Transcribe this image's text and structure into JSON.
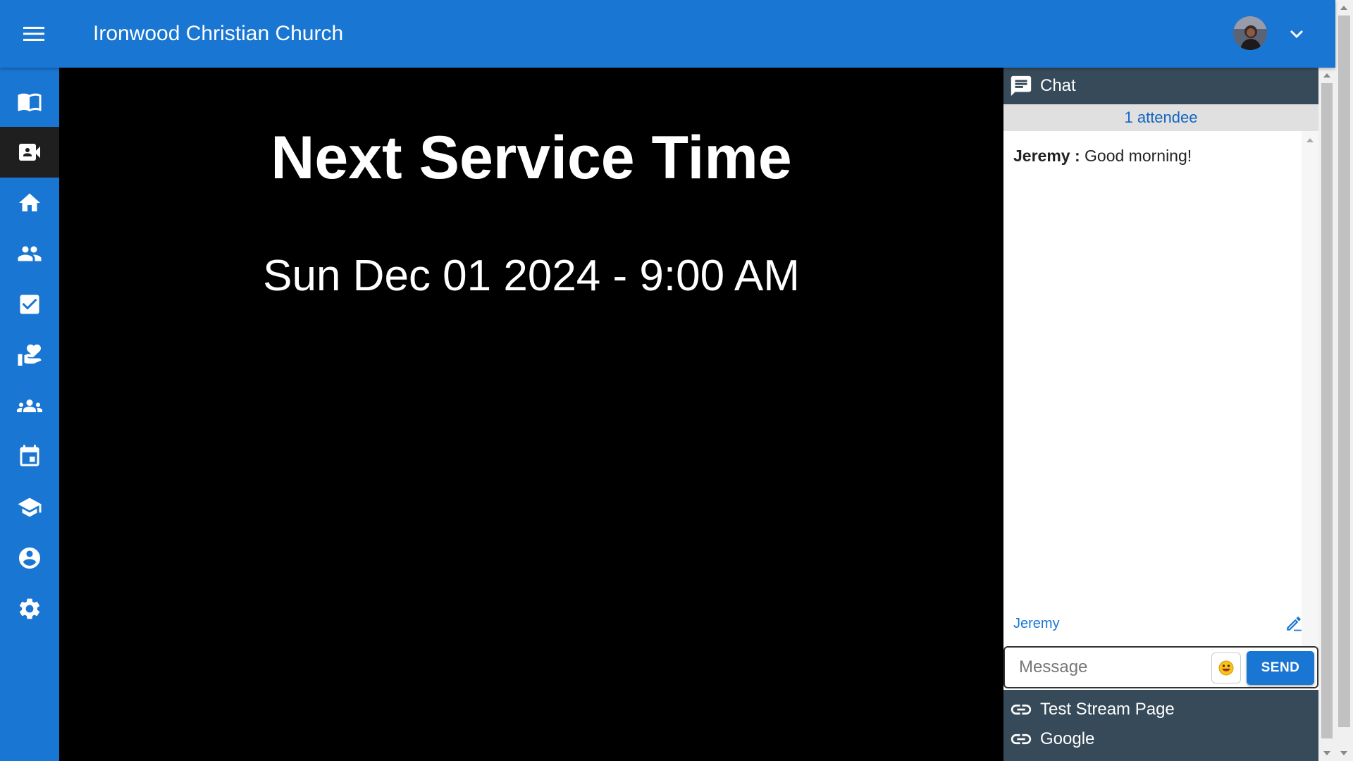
{
  "header": {
    "title": "Ironwood Christian Church",
    "menu_icon": "menu-icon",
    "avatar_icon": "user-avatar",
    "caret_icon": "chevron-down-icon"
  },
  "sidebar": {
    "items": [
      {
        "name": "sidebar-item-bible",
        "icon": "book-open-icon",
        "active": false
      },
      {
        "name": "sidebar-item-stream",
        "icon": "video-camera-icon",
        "active": true
      },
      {
        "name": "sidebar-item-home",
        "icon": "home-icon",
        "active": false
      },
      {
        "name": "sidebar-item-people",
        "icon": "people-icon",
        "active": false
      },
      {
        "name": "sidebar-item-tasks",
        "icon": "checkbox-icon",
        "active": false
      },
      {
        "name": "sidebar-item-donate",
        "icon": "volunteer-heart-icon",
        "active": false
      },
      {
        "name": "sidebar-item-groups",
        "icon": "groups-icon",
        "active": false
      },
      {
        "name": "sidebar-item-calendar",
        "icon": "calendar-icon",
        "active": false
      },
      {
        "name": "sidebar-item-learning",
        "icon": "school-icon",
        "active": false
      },
      {
        "name": "sidebar-item-profile",
        "icon": "account-circle-icon",
        "active": false
      },
      {
        "name": "sidebar-item-settings",
        "icon": "gear-icon",
        "active": false
      }
    ]
  },
  "stage": {
    "heading": "Next Service Time",
    "time": "Sun Dec 01 2024 - 9:00 AM"
  },
  "chat": {
    "title": "Chat",
    "attendees": "1 attendee",
    "messages": [
      {
        "author": "Jeremy :",
        "text": "Good morning!"
      }
    ],
    "current_user": "Jeremy",
    "input_placeholder": "Message",
    "send_label": "SEND"
  },
  "links": [
    {
      "label": "Test Stream Page"
    },
    {
      "label": "Google"
    }
  ],
  "colors": {
    "primary": "#1976d2",
    "panel_dark": "#374a5a",
    "stage_bg": "#000000"
  }
}
